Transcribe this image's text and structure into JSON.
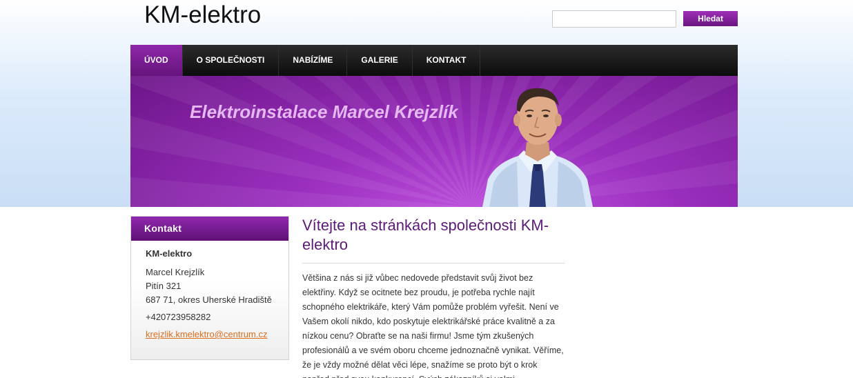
{
  "header": {
    "site_title": "KM-elektro",
    "search": {
      "value": "",
      "placeholder": "",
      "button_label": "Hledat"
    }
  },
  "nav": {
    "items": [
      {
        "label": "ÚVOD",
        "active": true
      },
      {
        "label": "O SPOLEČNOSTI",
        "active": false
      },
      {
        "label": "NABÍZÍME",
        "active": false
      },
      {
        "label": "GALERIE",
        "active": false
      },
      {
        "label": "KONTAKT",
        "active": false
      }
    ]
  },
  "banner": {
    "title": "Elektroinstalace Marcel Krejzlík"
  },
  "sidebar": {
    "heading": "Kontakt",
    "company": "KM-elektro",
    "address": [
      "Marcel Krejzlík",
      "Pitín 321",
      "687 71, okres Uherské Hradiště"
    ],
    "phone": "+420723958282",
    "email": "krejzlik.kmelektro@centrum.cz"
  },
  "main": {
    "title": "Vítejte na stránkách společnosti KM-elektro",
    "text": "Většina z nás si již vůbec nedovede představit svůj život bez elektřiny. Když se ocitnete bez proudu, je potřeba rychle najít schopného elektrikáře, který Vám pomůže problém vyřešit. Není ve Vašem okolí nikdo, kdo poskytuje elektrikářské práce kvalitně a za nízkou cenu? Obraťte se na naši firmu! Jsme tým zkušených profesionálů a ve svém oboru chceme jednoznačně vynikat. Věříme, že je vždy možné dělat věci lépe, snažíme se proto být o krok napřed před svou konkurencí. Svých zákazníků si velmi"
  },
  "colors": {
    "accent": "#8e27aa",
    "nav_background": "#1a1a1a",
    "banner_title": "#e5b8f2",
    "link": "#d96e1e",
    "heading": "#5c1a78"
  }
}
